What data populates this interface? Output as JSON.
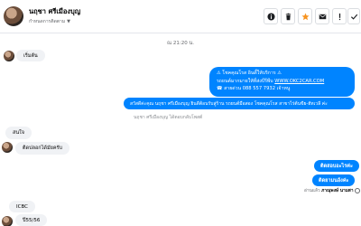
{
  "header": {
    "contact_name": "นฤชา ศรีเมืองบุญ",
    "contact_sub": "กำหนดการติดตาม",
    "actions": [
      "info",
      "delete",
      "star",
      "email",
      "more",
      "done"
    ]
  },
  "conversation": {
    "timestamp": "ณ 21:20 น.",
    "messages": [
      {
        "dir": "in",
        "text": "เริ่มต้น"
      },
      {
        "dir": "out",
        "lines": [
          "⚠ โชคคุณโรส อินดี้ให้บริการ ⚠",
          "รถยนต์มากมายให้ที่ส่งบีรีพีบ",
          "☎ สายด่วน 088 557 7932 เจ้าหนู"
        ],
        "link": "WWW.OKC2CAR.COM"
      },
      {
        "dir": "out",
        "text": "สวัสดีค่ะคุณ นฤชา ศรีเมืองบุญ ยินดีต้อนรับสู่ร้าน รถยนต์มือสอง โชคคุณโรส สาขาไร่ต้นขีย-ฮัทเวลี ค่ะ"
      },
      {
        "dir": "system",
        "text": "นฤชา ศรีเมืองบุญ ได้ตอบกลับโพสต์"
      },
      {
        "dir": "in",
        "text": "สนใจ"
      },
      {
        "dir": "in",
        "text": "ติดปลอกได้มัยครับ"
      },
      {
        "dir": "out",
        "text": "ติดสอบอะไรค่ะ"
      },
      {
        "dir": "out",
        "text": "ติดยามนอ้งค่ะ"
      },
      {
        "dir": "in",
        "text": "ICBC"
      },
      {
        "dir": "in",
        "text": "ปี55/56"
      }
    ],
    "seen_label": "อ่านแล้ว",
    "seen_by": "ภาณุพงษ์ นามสา"
  },
  "colors": {
    "outgoing_bubble": "#0084ff",
    "incoming_bubble": "#f0f2f5",
    "star_icon": "#f7931e"
  }
}
